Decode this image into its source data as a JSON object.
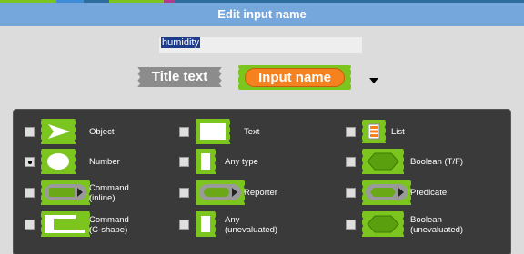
{
  "dialog": {
    "title": "Edit input name"
  },
  "input_field": {
    "value": "humidity"
  },
  "preview": {
    "title_block_text": "Title text",
    "input_block_text": "Input name"
  },
  "colors": {
    "title_bar": "#75a7dc",
    "block_green": "#7cc41e",
    "pill_orange": "#f5821f",
    "title_gray": "#8c8c8c",
    "panel_bg": "#3a3a3a"
  },
  "type_options": [
    {
      "line1": "Object",
      "line2": "",
      "icon": "object-arrow-icon",
      "selected": false
    },
    {
      "line1": "Text",
      "line2": "",
      "icon": "text-slot-icon",
      "selected": false
    },
    {
      "line1": "List",
      "line2": "",
      "icon": "list-icon",
      "selected": false
    },
    {
      "line1": "Number",
      "line2": "",
      "icon": "number-oval-icon",
      "selected": true
    },
    {
      "line1": "Any type",
      "line2": "",
      "icon": "any-type-icon",
      "selected": false
    },
    {
      "line1": "Boolean (T/F)",
      "line2": "",
      "icon": "boolean-hexagon-icon",
      "selected": false
    },
    {
      "line1": "Command",
      "line2": "(inline)",
      "icon": "command-inline-icon",
      "selected": false
    },
    {
      "line1": "Reporter",
      "line2": "",
      "icon": "reporter-ring-icon",
      "selected": false
    },
    {
      "line1": "Predicate",
      "line2": "",
      "icon": "predicate-ring-icon",
      "selected": false
    },
    {
      "line1": "Command",
      "line2": "(C-shape)",
      "icon": "command-c-shape-icon",
      "selected": false
    },
    {
      "line1": "Any",
      "line2": "(unevaluated)",
      "icon": "any-unevaluated-icon",
      "selected": false
    },
    {
      "line1": "Boolean",
      "line2": "(unevaluated)",
      "icon": "boolean-unevaluated-icon",
      "selected": false
    }
  ]
}
